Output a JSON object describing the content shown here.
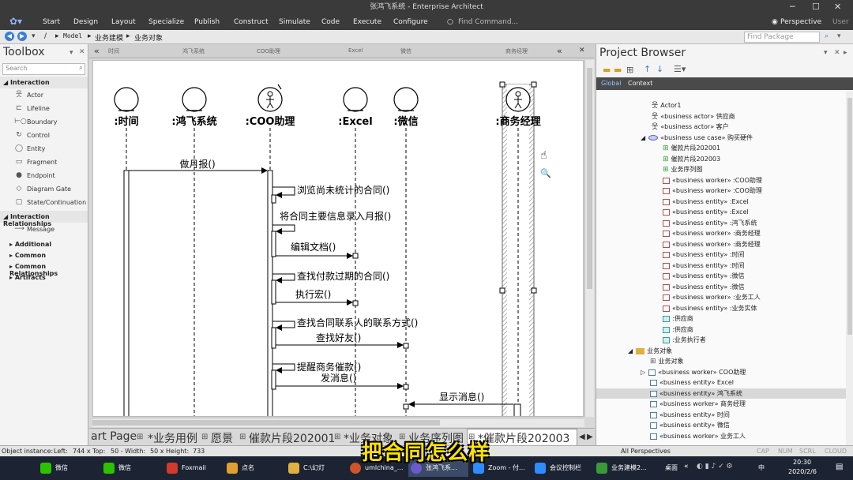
{
  "window": {
    "title": "张鸿飞系统 - Enterprise Architect"
  },
  "menu": {
    "items": [
      "Start",
      "Design",
      "Layout",
      "Specialize",
      "Publish",
      "Construct",
      "Simulate",
      "Code",
      "Execute",
      "Configure"
    ],
    "find_command": "Find Command...",
    "perspective": "Perspective",
    "user": "User"
  },
  "address": {
    "path": [
      "/",
      "Model",
      "业务建模",
      "业务对象"
    ],
    "find_package": "Find Package"
  },
  "toolbox": {
    "title": "Toolbox",
    "search_placeholder": "Search",
    "interaction_header": "Interaction",
    "interaction_items": [
      "Actor",
      "Lifeline",
      "Boundary",
      "Control",
      "Entity",
      "Fragment",
      "Endpoint",
      "Diagram Gate",
      "State/Continuation"
    ],
    "relationships_header": "Interaction Relationships",
    "relationships_items": [
      "Message"
    ],
    "extra_sections": [
      "Additional",
      "Common",
      "Common Relationships",
      "Artifacts"
    ]
  },
  "diagram": {
    "header_labels": [
      "时间",
      "鸿飞系统",
      "COO助理",
      "Excel",
      "微信",
      "商务经理"
    ],
    "lifelines": [
      ":时间",
      ":鸿飞系统",
      ":COO助理",
      ":Excel",
      ":微信",
      ":商务经理"
    ],
    "messages": [
      "做月报()",
      "浏览尚未统计的合同()",
      "将合同主要信息录入月报()",
      "编辑文档()",
      "查找付款过期的合同()",
      "执行宏()",
      "查找合同联系人的联系方式()",
      "查找好友()",
      "提醒商务催款()",
      "发消息()",
      "显示消息()"
    ]
  },
  "tabs": [
    "art Page",
    "*业务用例",
    "愿景",
    "催款片段202001",
    "*业务对象",
    "业务序列图",
    "*催款片段202003"
  ],
  "project_browser": {
    "title": "Project Browser",
    "tabs": [
      "Global",
      "Context"
    ],
    "rows": [
      "Actor1",
      "«business actor» 供应商",
      "«business actor» 客户",
      "«business use case» 购买硬件",
      "催款片段202001",
      "催款片段202003",
      "业务序列图",
      "«business worker» :COO助理",
      "«business worker» :COO助理",
      "«business entity» :Excel",
      "«business entity» :Excel",
      "«business entity» :鸿飞系统",
      "«business worker» :商务经理",
      "«business worker» :商务经理",
      "«business entity» :时间",
      "«business entity» :时间",
      "«business entity» :微信",
      "«business entity» :微信",
      "«business worker» :业务工人",
      "«business entity» :业务实体",
      ":供应商",
      ":供应商",
      ":业务执行者",
      "业务对象",
      "业务对象",
      "«business worker» COO助理",
      "«business entity» Excel",
      "«business entity» 鸿飞系统",
      "«business worker» 商务经理",
      "«business entity» 时间",
      "«business entity» 微信",
      "«business worker» 业务工人"
    ]
  },
  "status": {
    "object_instance": "Object instance:",
    "left": "Left:",
    "left_val": "744 x Top:",
    "top_val": "50 - Width:",
    "width_val": "50 x Height:",
    "height_val": "733",
    "perspectives": "All Perspectives",
    "caps": "CAP",
    "num": "NUM",
    "scrl": "SCRL",
    "cloud": "CLOUD"
  },
  "taskbar": {
    "items": [
      "微信",
      "微信",
      "Foxmail",
      "点名",
      "C:\\幻灯",
      "umlchina_...",
      "张鸿飞系...",
      "Zoom - 付...",
      "会议控制栏",
      "业务建模2..."
    ],
    "desktop": "桌面",
    "time": "20:30",
    "date": "2020/2/6",
    "lang": "中"
  },
  "caption": "把合同怎么样"
}
